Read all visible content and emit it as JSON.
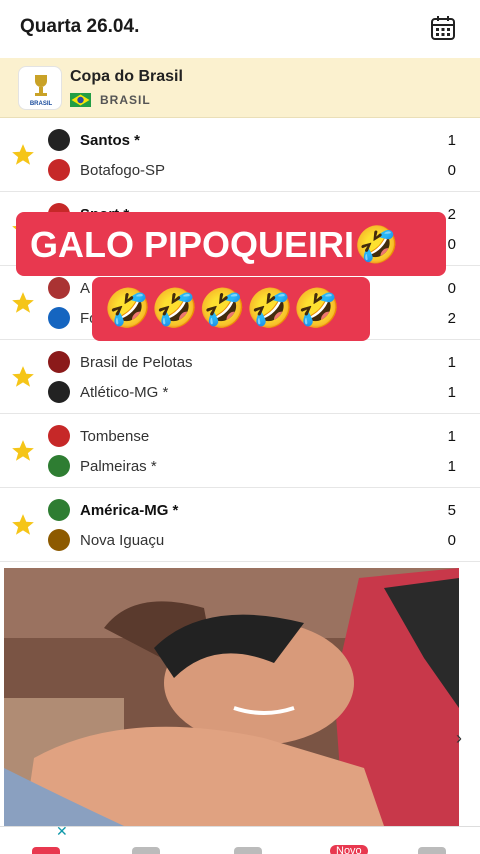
{
  "header": {
    "date": "Quarta 26.04."
  },
  "competition": {
    "name": "Copa do Brasil",
    "country": "BRASIL",
    "logo_text": "BRASIL"
  },
  "matches": [
    {
      "home": "Santos *",
      "home_bold": true,
      "home_score": "1",
      "away": "Botafogo-SP",
      "away_score": "0"
    },
    {
      "home": "Sport *",
      "home_bold": true,
      "home_score": "2",
      "away": "",
      "away_score": "0"
    },
    {
      "home": "A",
      "home_bold": false,
      "home_score": "0",
      "away": "Fo",
      "away_score": "2"
    },
    {
      "home": "Brasil de Pelotas",
      "home_bold": false,
      "home_score": "1",
      "away": "Atlético-MG *",
      "away_score": "1"
    },
    {
      "home": "Tombense",
      "home_bold": false,
      "home_score": "1",
      "away": "Palmeiras *",
      "away_score": "1"
    },
    {
      "home": "América-MG *",
      "home_bold": true,
      "home_score": "5",
      "away": "Nova Iguaçu",
      "away_score": "0"
    }
  ],
  "overlay": {
    "line1": "GALO PIPOQUEIRI🤣",
    "line2": "🤣🤣🤣🤣🤣"
  },
  "ad": {
    "close": "✕"
  },
  "tabbar": {
    "badge": "Novo"
  },
  "colors": {
    "accent": "#e8384f",
    "star": "#f5c518",
    "competition_bg": "#fbf1cf"
  },
  "icons": {
    "calendar": "calendar-icon",
    "star": "star-icon",
    "chevron": "chevron-right-icon"
  }
}
